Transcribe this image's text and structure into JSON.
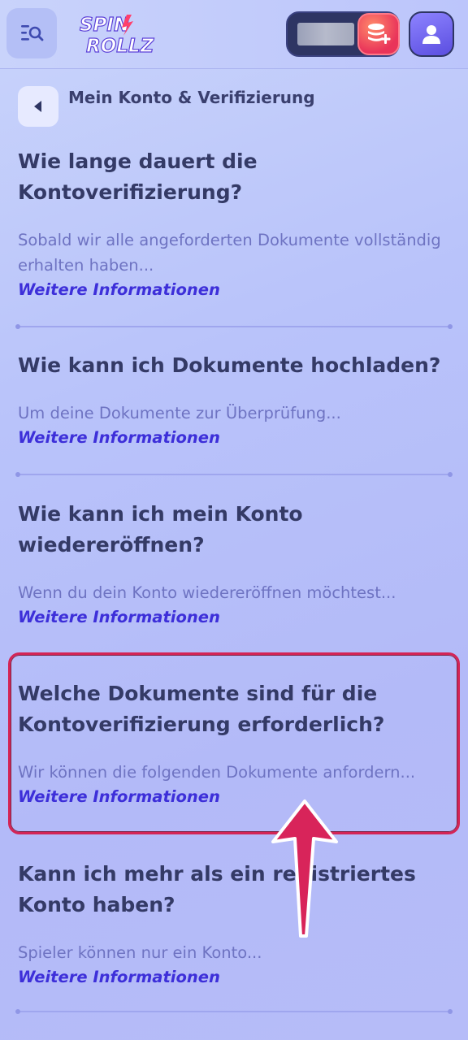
{
  "header": {
    "logo_line1": "SPIN",
    "logo_line2": "ROLLZ",
    "menu_icon": "search-menu-icon",
    "deposit_icon": "coins-plus-icon",
    "profile_icon": "user-icon"
  },
  "breadcrumb": {
    "label": "Mein Konto & Verifizierung"
  },
  "faq": [
    {
      "question": "Wie lange dauert die Kontoverifizierung?",
      "answer": "Sobald wir alle angeforderten Dokumente vollständig erhalten haben...",
      "more": "Weitere Informationen"
    },
    {
      "question": "Wie kann ich Dokumente hochladen?",
      "answer": "Um deine Dokumente zur Überprüfung...",
      "more": "Weitere Informationen"
    },
    {
      "question": "Wie kann ich mein Konto wiedereröffnen?",
      "answer": "Wenn du dein Konto wiedereröffnen möchtest...",
      "more": "Weitere Informationen"
    },
    {
      "question": "Welche Dokumente sind für die Kontoverifizierung erforderlich?",
      "answer": "Wir können die folgenden Dokumente anfordern...",
      "more": "Weitere Informationen"
    },
    {
      "question": "Kann ich mehr als ein registriertes Konto haben?",
      "answer": "Spieler können nur ein Konto...",
      "more": "Weitere Informationen"
    }
  ],
  "colors": {
    "highlight": "#d42456",
    "link": "#3d2fd9",
    "question": "#343a66",
    "answer": "#6e73c2"
  }
}
